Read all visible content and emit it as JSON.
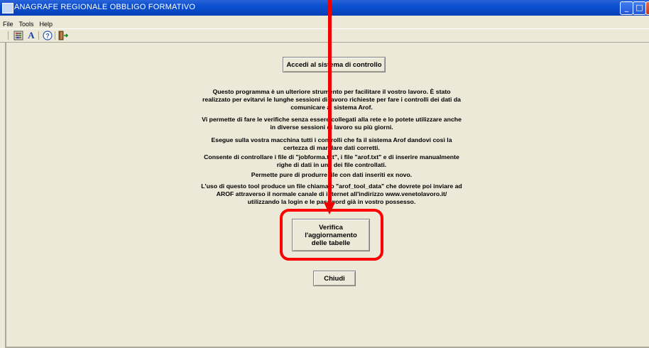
{
  "window": {
    "title": "ANAGRAFE REGIONALE OBBLIGO FORMATIVO",
    "minimize_glyph": "_",
    "maximize_glyph": "□",
    "close_glyph": "×"
  },
  "menu": {
    "items": [
      {
        "label": "File"
      },
      {
        "label": "Tools"
      },
      {
        "label": "Help"
      }
    ]
  },
  "toolbar": {
    "icons": [
      "settings-icon",
      "font-icon",
      "help-icon",
      "exit-icon"
    ]
  },
  "main": {
    "access_button_label": "Accedi al sistema di controllo",
    "paragraphs": [
      "Questo programma è un ulteriore strumento per facilitare il vostro lavoro. È stato realizzato per evitarvi le lunghe sessioni di lavoro richieste per fare i controlli dei dati da comunicare al sistema Arof.",
      "Vi permette di fare le verifiche senza essere collegati alla rete e lo potete utilizzare anche in diverse sessioni di lavoro su più giorni.",
      "Esegue sulla vostra macchina tutti i controlli che fa il sistema Arof dandovi così la certezza di mandare dati corretti.",
      "Consente di controllare i file di \"jobforma.txt\", i file \"arof.txt\" e di inserire manualmente righe di dati in uno dei file controllati.",
      "Permette pure di produrre file con dati inseriti ex novo.",
      "L'uso di questo tool produce un file chiamato \"arof_tool_data\" che dovrete poi inviare ad AROF attraverso il normale canale di internet all'indirizzo www.venetolavoro.it/ utilizzando la login e le password già in vostro possesso."
    ],
    "verify_button_label": "Verifica l'aggiornamento delle tabelle",
    "close_button_label": "Chiudi"
  },
  "colors": {
    "titlebar": "#0a4fd0",
    "annotation": "#ee0000",
    "background": "#ece9d8"
  }
}
